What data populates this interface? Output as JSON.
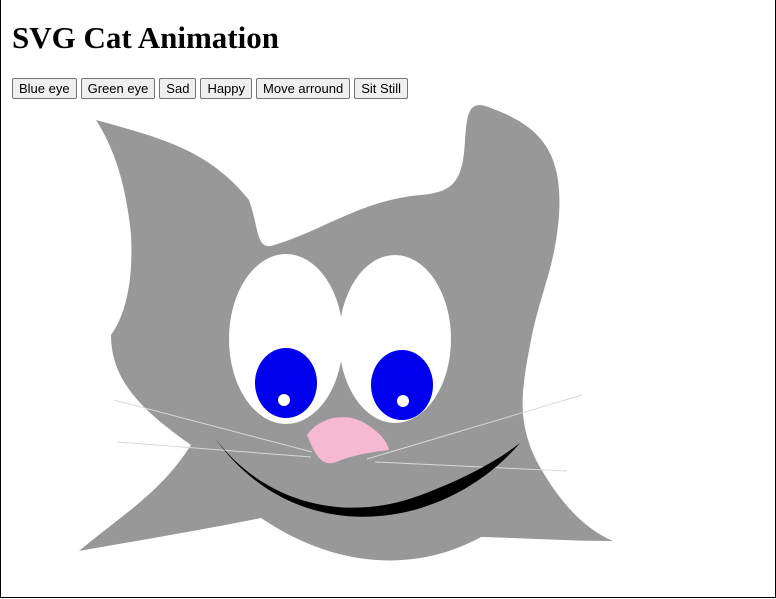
{
  "page": {
    "title": "SVG Cat Animation"
  },
  "toolbar": {
    "buttons": [
      {
        "label": "Blue eye"
      },
      {
        "label": "Green eye"
      },
      {
        "label": "Sad"
      },
      {
        "label": "Happy"
      },
      {
        "label": "Move arround"
      },
      {
        "label": "Sit Still"
      }
    ]
  },
  "cat": {
    "fur_color": "#989898",
    "eye_white_color": "#ffffff",
    "iris_color": "#0000ee",
    "nose_color": "#f7b8d2",
    "mouth_color": "#000000",
    "whisker_color": "#d8d8d8",
    "mood": "happy"
  }
}
